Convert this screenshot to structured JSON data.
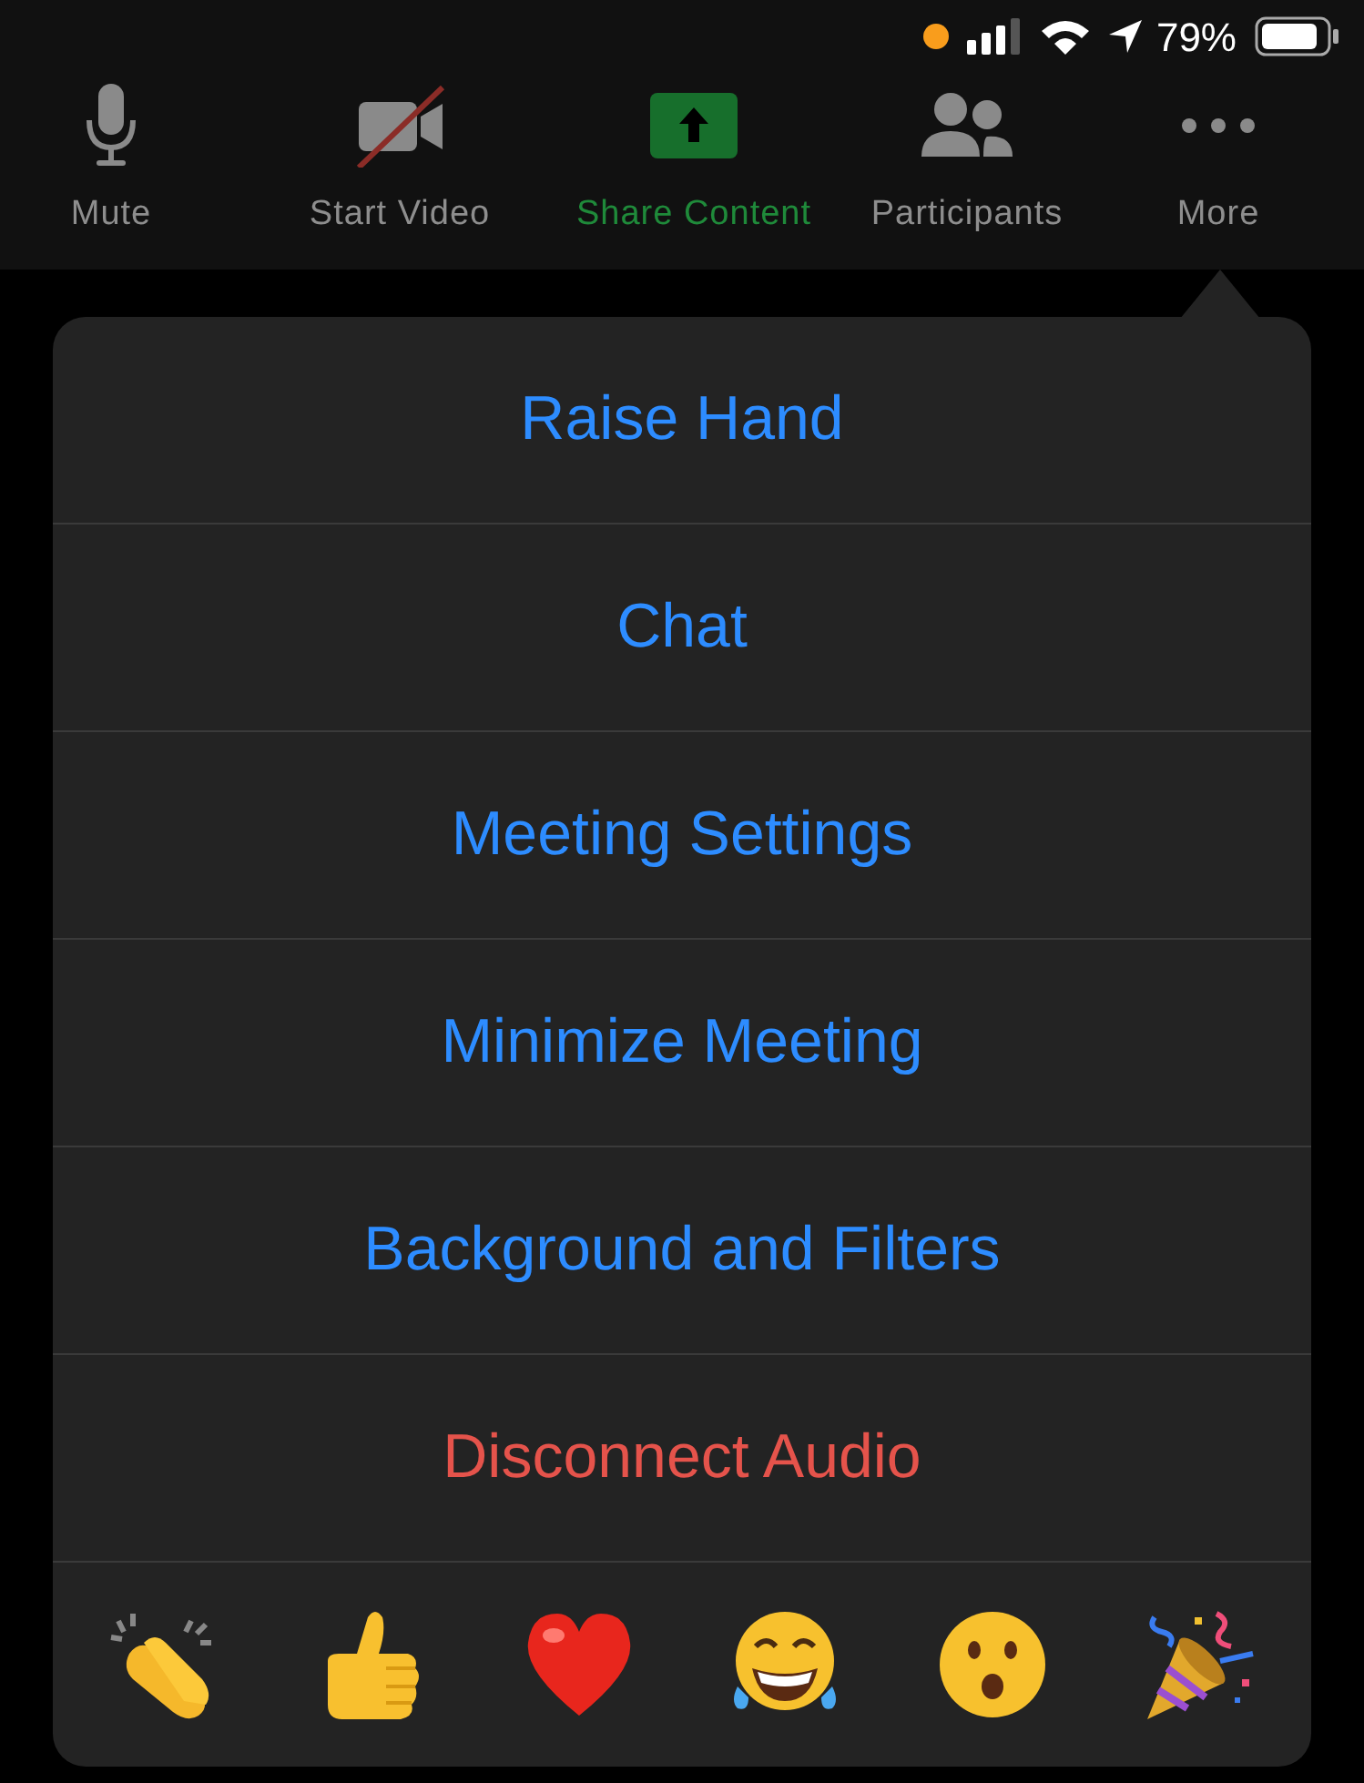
{
  "status_bar": {
    "battery": "79%"
  },
  "toolbar": [
    {
      "kind": "mic",
      "label": "Mute",
      "active": false
    },
    {
      "kind": "video-off",
      "label": "Start Video",
      "active": false
    },
    {
      "kind": "share",
      "label": "Share Content",
      "active": true
    },
    {
      "kind": "people",
      "label": "Participants",
      "active": false
    },
    {
      "kind": "more",
      "label": "More",
      "active": false
    }
  ],
  "menu": [
    {
      "label": "Raise Hand",
      "destructive": false
    },
    {
      "label": "Chat",
      "destructive": false
    },
    {
      "label": "Meeting Settings",
      "destructive": false
    },
    {
      "label": "Minimize Meeting",
      "destructive": false
    },
    {
      "label": "Background and Filters",
      "destructive": false
    },
    {
      "label": "Disconnect Audio",
      "destructive": true
    }
  ],
  "reactions": [
    {
      "kind": "clap"
    },
    {
      "kind": "thumbs-up"
    },
    {
      "kind": "heart"
    },
    {
      "kind": "laugh"
    },
    {
      "kind": "surprised"
    },
    {
      "kind": "party"
    }
  ]
}
